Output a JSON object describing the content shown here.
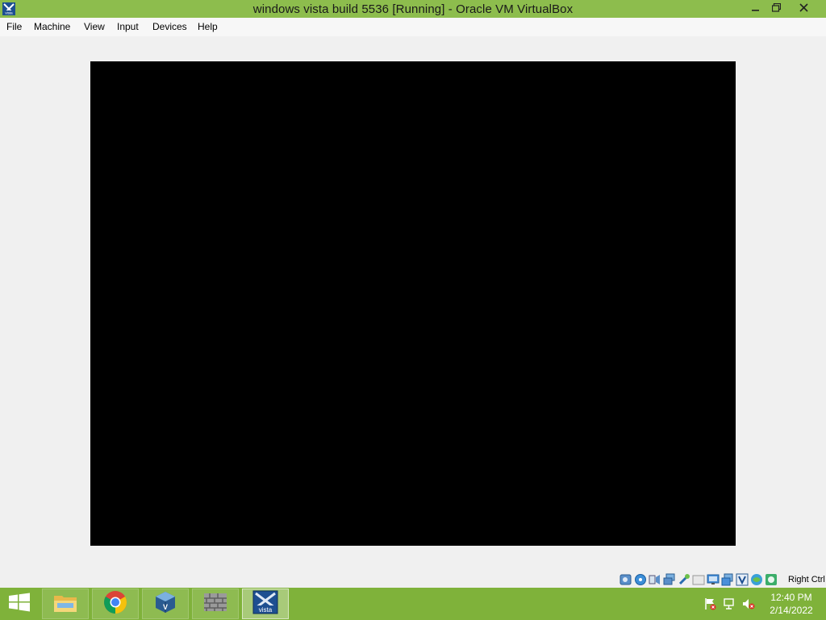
{
  "window": {
    "title": "windows vista build 5536 [Running] - Oracle VM VirtualBox",
    "app_icon": "virtualbox-vista-icon",
    "controls": {
      "minimize_icon": "minimize-icon",
      "restore_icon": "restore-icon",
      "close_icon": "close-icon"
    }
  },
  "menubar": {
    "items": [
      "File",
      "Machine",
      "View",
      "Input",
      "Devices",
      "Help"
    ]
  },
  "vm_screen": {
    "content": "",
    "background": "#000000"
  },
  "statusbar": {
    "icons": [
      "hard-disk-icon",
      "optical-drive-icon",
      "audio-icon",
      "network-icon",
      "usb-icon",
      "shared-folders-icon",
      "display-icon",
      "recording-icon",
      "virtualization-icon",
      "guest-additions-icon",
      "mouse-integration-icon"
    ],
    "host_key": "Right Ctrl"
  },
  "taskbar": {
    "start_icon": "windows-start-icon",
    "apps": [
      {
        "icon": "file-explorer-icon",
        "active": false
      },
      {
        "icon": "chrome-icon",
        "active": false
      },
      {
        "icon": "virtualbox-manager-icon",
        "active": false
      },
      {
        "icon": "firewall-wall-icon",
        "active": false
      },
      {
        "icon": "vista-vm-icon",
        "active": true
      }
    ],
    "tray_icons": [
      "action-center-flag-icon",
      "network-tray-icon",
      "volume-muted-icon"
    ],
    "clock": {
      "time": "12:40 PM",
      "date": "2/14/2022"
    }
  },
  "colors": {
    "title_bar": "#8dbd4d",
    "taskbar": "#7fb23a",
    "vm_background": "#000000"
  }
}
